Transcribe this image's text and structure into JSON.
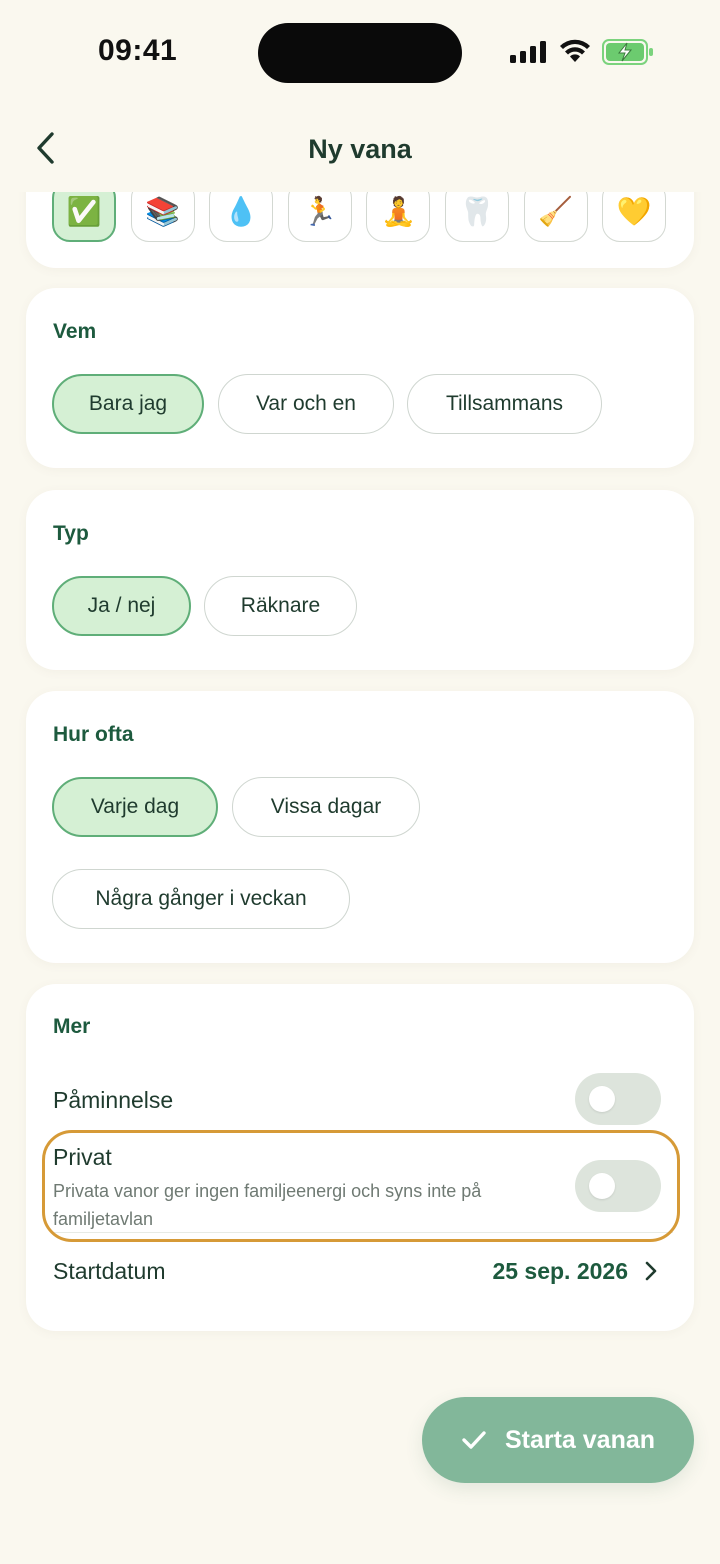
{
  "status_bar": {
    "time": "09:41"
  },
  "header": {
    "title": "Ny vana"
  },
  "emoji_picker": {
    "items": [
      {
        "icon": "✅",
        "name": "check-mark"
      },
      {
        "icon": "📚",
        "name": "books"
      },
      {
        "icon": "💧",
        "name": "droplet"
      },
      {
        "icon": "🏃",
        "name": "runner"
      },
      {
        "icon": "🧘",
        "name": "meditation"
      },
      {
        "icon": "🦷",
        "name": "tooth"
      },
      {
        "icon": "🧹",
        "name": "broom"
      },
      {
        "icon": "💛",
        "name": "yellow-heart"
      }
    ],
    "selected_index": 0
  },
  "who": {
    "label": "Vem",
    "options": [
      "Bara jag",
      "Var och en",
      "Tillsammans"
    ],
    "selected": "Bara jag"
  },
  "type": {
    "label": "Typ",
    "options": [
      "Ja / nej",
      "Räknare"
    ],
    "selected": "Ja / nej"
  },
  "frequency": {
    "label": "Hur ofta",
    "options": [
      "Varje dag",
      "Vissa dagar",
      "Några gånger i veckan"
    ],
    "selected": "Varje dag"
  },
  "more": {
    "label": "Mer",
    "reminder": {
      "label": "Påminnelse",
      "enabled": false
    },
    "private": {
      "label": "Privat",
      "description": "Privata vanor ger ingen familjeenergi och syns inte på familjetavlan",
      "enabled": false
    },
    "start_date": {
      "label": "Startdatum",
      "value": "25 sep. 2026"
    }
  },
  "cta": {
    "label": "Starta vanan"
  },
  "colors": {
    "background": "#faf8ef",
    "accent": "#1d5a3e",
    "selected_fill": "#d5f0d4",
    "cta": "#82b79a",
    "highlight": "#d69a37"
  }
}
